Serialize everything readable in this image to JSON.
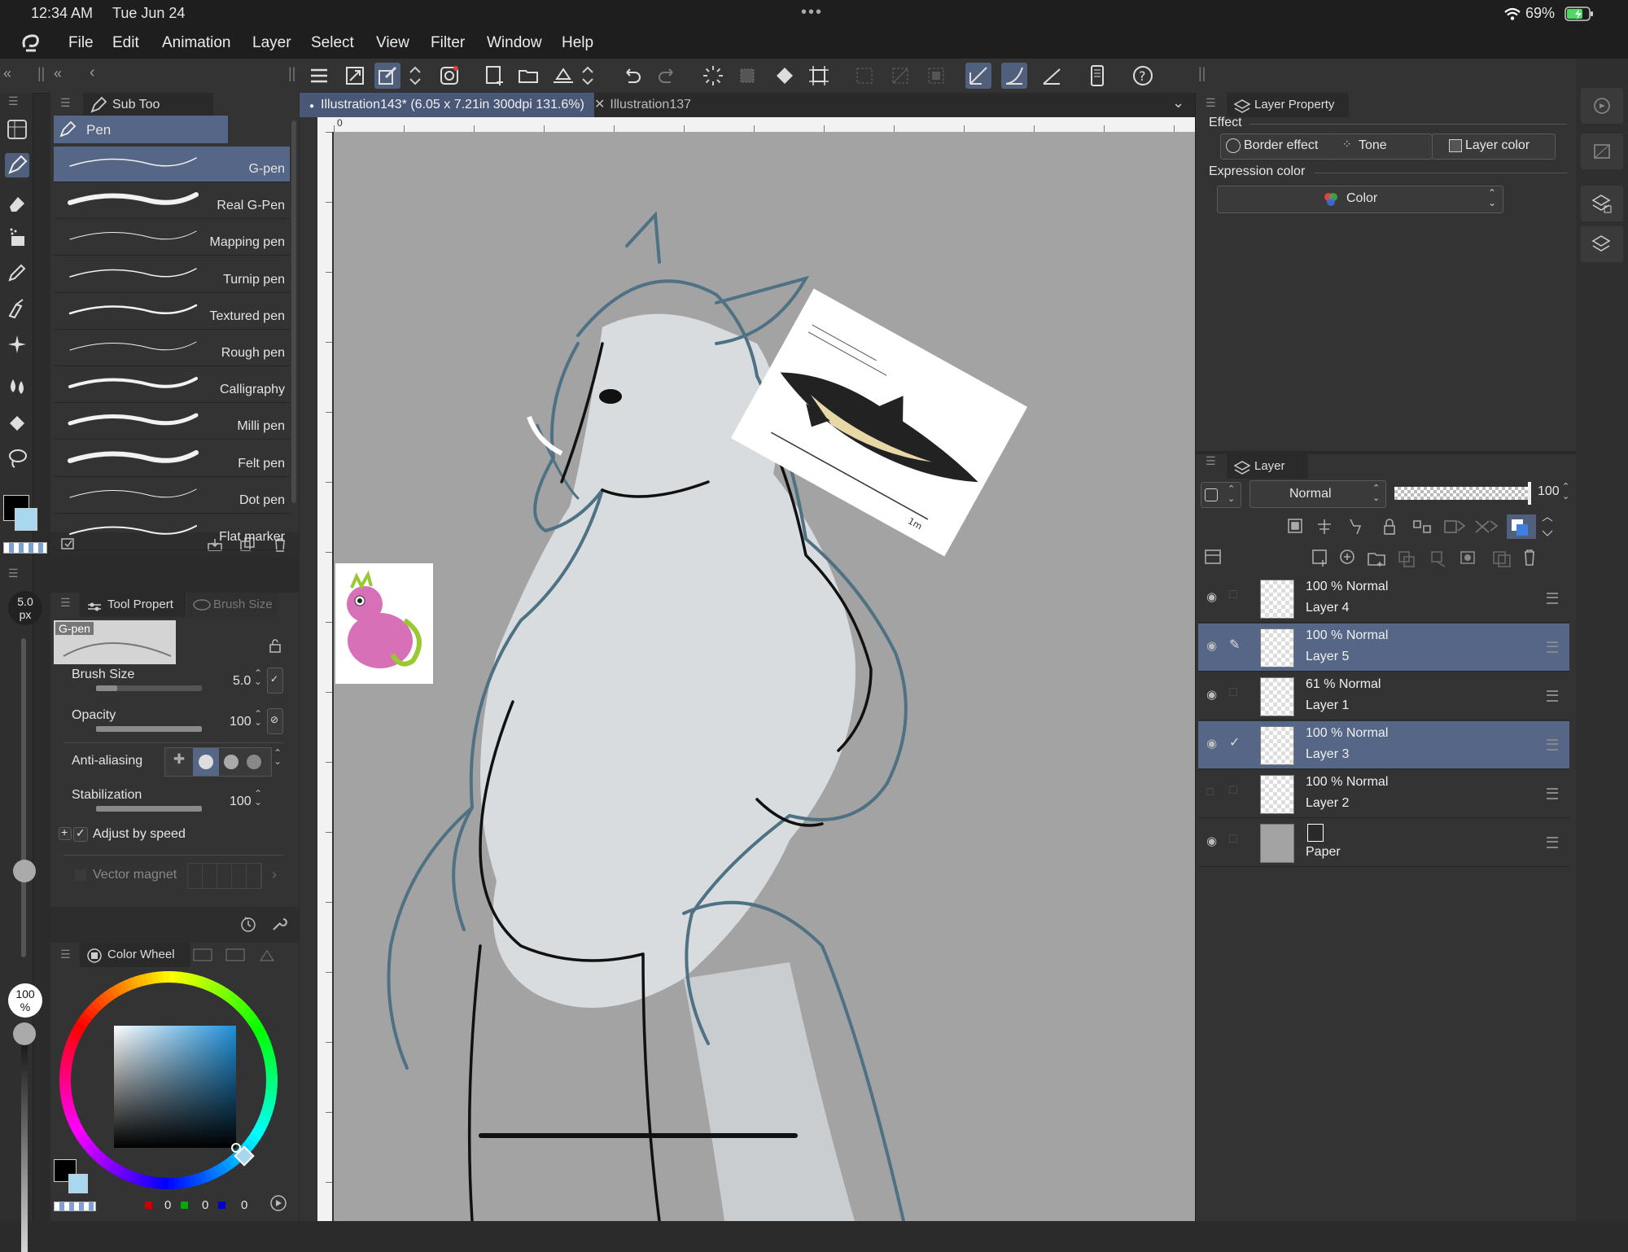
{
  "status": {
    "time": "12:34 AM",
    "date": "Tue Jun 24",
    "battery": "69%"
  },
  "menu": [
    "File",
    "Edit",
    "Animation",
    "Layer",
    "Select",
    "View",
    "Filter",
    "Window",
    "Help"
  ],
  "subtool": {
    "tab_label": "Sub Too",
    "group": "Pen",
    "items": [
      "G-pen",
      "Real G-Pen",
      "Mapping pen",
      "Turnip pen",
      "Textured pen",
      "Rough pen",
      "Calligraphy",
      "Milli pen",
      "Felt pen",
      "Dot pen",
      "Flat marker"
    ],
    "selected": "G-pen"
  },
  "brush_size_indicator": {
    "value": "5.0",
    "unit": "px"
  },
  "zoom_indicator": {
    "value": "100",
    "unit": "%"
  },
  "tool_property": {
    "tab1": "Tool Propert",
    "tab2": "Brush Size",
    "preset_name": "G-pen",
    "brush_size_label": "Brush Size",
    "brush_size_value": "5.0",
    "brush_size_fraction": 0.2,
    "opacity_label": "Opacity",
    "opacity_value": "100",
    "opacity_fraction": 1.0,
    "antialias_label": "Anti-aliasing",
    "stabilization_label": "Stabilization",
    "stabilization_value": "100",
    "stabilization_fraction": 1.0,
    "adjust_speed_label": "Adjust by speed",
    "vector_magnet_label": "Vector magnet"
  },
  "color_wheel": {
    "tab_label": "Color Wheel",
    "r": "0",
    "g": "0",
    "b": "0"
  },
  "tabs": {
    "active": "Illustration143* (6.05 x 7.21in 300dpi 131.6%)",
    "other": "Illustration137"
  },
  "ruler": {
    "zero": "0"
  },
  "layer_property": {
    "title": "Layer Property",
    "effect_label": "Effect",
    "border_effect": "Border effect",
    "tone": "Tone",
    "layer_color": "Layer color",
    "expression_label": "Expression color",
    "expression_value": "Color"
  },
  "layer_panel": {
    "title": "Layer",
    "blend_mode": "Normal",
    "opacity": "100",
    "layers": [
      {
        "top": "100 % Normal",
        "name": "Layer 4",
        "selected": false
      },
      {
        "top": "100 % Normal",
        "name": "Layer 5",
        "selected": true
      },
      {
        "top": "61 % Normal",
        "name": "Layer 1",
        "selected": false
      },
      {
        "top": "100 % Normal",
        "name": "Layer 3",
        "selected": true
      },
      {
        "top": "100 % Normal",
        "name": "Layer 2",
        "selected": false
      },
      {
        "top": "",
        "name": "Paper",
        "selected": false
      }
    ]
  },
  "colors": {
    "accent": "#566686",
    "canvas": "#a3a3a3",
    "line_blue": "#4e7183",
    "fg": "#000000",
    "bg": "#a8d8f0"
  },
  "reference_image": {
    "scale_label": "1m"
  }
}
